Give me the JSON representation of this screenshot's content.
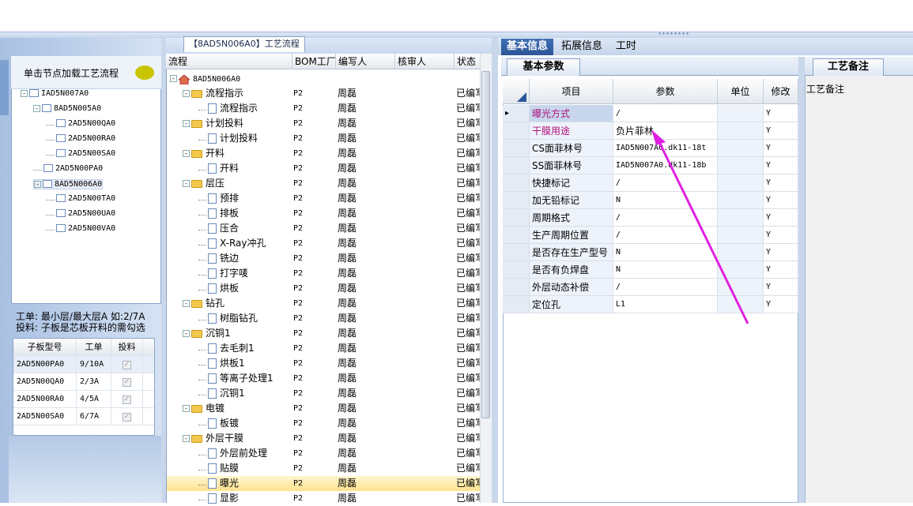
{
  "left": {
    "load_title": "单击节点加载工艺流程",
    "tree": [
      {
        "label": "IAD5N007A0",
        "level": 0,
        "pm": "-"
      },
      {
        "label": "8AD5N005A0",
        "level": 1,
        "pm": "-"
      },
      {
        "label": "2AD5N00QA0",
        "level": 2,
        "pm": ""
      },
      {
        "label": "2AD5N00RA0",
        "level": 2,
        "pm": ""
      },
      {
        "label": "2AD5N00SA0",
        "level": 2,
        "pm": ""
      },
      {
        "label": "2AD5N00PA0",
        "level": 1,
        "pm": ""
      },
      {
        "label": "8AD5N006A0",
        "level": 1,
        "pm": "-",
        "selected": true
      },
      {
        "label": "2AD5N00TA0",
        "level": 2,
        "pm": ""
      },
      {
        "label": "2AD5N00UA0",
        "level": 2,
        "pm": ""
      },
      {
        "label": "2AD5N00VA0",
        "level": 2,
        "pm": ""
      }
    ],
    "info_line1": "工单: 最小层/最大层A 如:2/7A",
    "info_line2": "投料: 子板是芯板开料的需勾选",
    "subgrid": {
      "headers": [
        "子板型号",
        "工单",
        "投料"
      ],
      "rows": [
        {
          "model": "2AD5N00PA0",
          "order": "9/10A",
          "check": "✓"
        },
        {
          "model": "2AD5N00QA0",
          "order": "2/3A",
          "check": "✓"
        },
        {
          "model": "2AD5N00RA0",
          "order": "4/5A",
          "check": "✓"
        },
        {
          "model": "2AD5N00SA0",
          "order": "6/7A",
          "check": "✓"
        }
      ]
    }
  },
  "middle": {
    "title": "【8AD5N006A0】工艺流程",
    "headers": [
      "流程",
      "BOM工厂",
      "编写人",
      "核审人",
      "状态"
    ],
    "root": "8AD5N006A0",
    "rows": [
      {
        "name": "流程指示",
        "type": "folder",
        "factory": "P2",
        "writer": "周磊",
        "status": "已编写"
      },
      {
        "name": "流程指示",
        "type": "doc",
        "factory": "P2",
        "writer": "周磊",
        "status": "已编写"
      },
      {
        "name": "计划投料",
        "type": "folder",
        "factory": "P2",
        "writer": "周磊",
        "status": "已编写"
      },
      {
        "name": "计划投料",
        "type": "doc",
        "factory": "P2",
        "writer": "周磊",
        "status": "已编写"
      },
      {
        "name": "开料",
        "type": "folder",
        "factory": "P2",
        "writer": "周磊",
        "status": "已编写"
      },
      {
        "name": "开料",
        "type": "doc",
        "factory": "P2",
        "writer": "周磊",
        "status": "已编写"
      },
      {
        "name": "层压",
        "type": "folder",
        "factory": "P2",
        "writer": "周磊",
        "status": "已编写"
      },
      {
        "name": "预排",
        "type": "doc",
        "factory": "P2",
        "writer": "周磊",
        "status": "已编写"
      },
      {
        "name": "排板",
        "type": "doc",
        "factory": "P2",
        "writer": "周磊",
        "status": "已编写"
      },
      {
        "name": "压合",
        "type": "doc",
        "factory": "P2",
        "writer": "周磊",
        "status": "已编写"
      },
      {
        "name": "X-Ray冲孔",
        "type": "doc",
        "factory": "P2",
        "writer": "周磊",
        "status": "已编写"
      },
      {
        "name": "铣边",
        "type": "doc",
        "factory": "P2",
        "writer": "周磊",
        "status": "已编写"
      },
      {
        "name": "打字唛",
        "type": "doc",
        "factory": "P2",
        "writer": "周磊",
        "status": "已编写"
      },
      {
        "name": "烘板",
        "type": "doc",
        "factory": "P2",
        "writer": "周磊",
        "status": "已编写"
      },
      {
        "name": "钻孔",
        "type": "folder",
        "factory": "P2",
        "writer": "周磊",
        "status": "已编写"
      },
      {
        "name": "树脂钻孔",
        "type": "doc",
        "factory": "P2",
        "writer": "周磊",
        "status": "已编写"
      },
      {
        "name": "沉铜1",
        "type": "folder",
        "factory": "P2",
        "writer": "周磊",
        "status": "已编写"
      },
      {
        "name": "去毛刺1",
        "type": "doc",
        "factory": "P2",
        "writer": "周磊",
        "status": "已编写"
      },
      {
        "name": "烘板1",
        "type": "doc",
        "factory": "P2",
        "writer": "周磊",
        "status": "已编写"
      },
      {
        "name": "等离子处理1",
        "type": "doc",
        "factory": "P2",
        "writer": "周磊",
        "status": "已编写"
      },
      {
        "name": "沉铜1",
        "type": "doc",
        "factory": "P2",
        "writer": "周磊",
        "status": "已编写"
      },
      {
        "name": "电镀",
        "type": "folder",
        "factory": "P2",
        "writer": "周磊",
        "status": "已编写"
      },
      {
        "name": "板镀",
        "type": "doc",
        "factory": "P2",
        "writer": "周磊",
        "status": "已编写"
      },
      {
        "name": "外层干膜",
        "type": "folder",
        "factory": "P2",
        "writer": "周磊",
        "status": "已编写"
      },
      {
        "name": "外层前处理",
        "type": "doc",
        "factory": "P2",
        "writer": "周磊",
        "status": "已编写"
      },
      {
        "name": "贴膜",
        "type": "doc",
        "factory": "P2",
        "writer": "周磊",
        "status": "已编写"
      },
      {
        "name": "曝光",
        "type": "doc",
        "factory": "P2",
        "writer": "周磊",
        "status": "已编写",
        "selected": true
      },
      {
        "name": "显影",
        "type": "doc",
        "factory": "P2",
        "writer": "周磊",
        "status": "已编写"
      }
    ]
  },
  "right": {
    "tabs": [
      "基本信息",
      "拓展信息",
      "工时"
    ],
    "subtab": "基本参数",
    "headers": [
      "项目",
      "参数",
      "单位",
      "修改"
    ],
    "rows": [
      {
        "item": "曝光方式",
        "param": "/",
        "unit": "",
        "mod": "Y",
        "highlight": true,
        "current": true
      },
      {
        "item": "干膜用途",
        "param": "负片菲林",
        "unit": "",
        "mod": "Y",
        "highlight": true
      },
      {
        "item": "CS面菲林号",
        "param": "IAD5N007A0.dk11-18t",
        "unit": "",
        "mod": "Y"
      },
      {
        "item": "SS面菲林号",
        "param": "IAD5N007A0.dk11-18b",
        "unit": "",
        "mod": "Y"
      },
      {
        "item": "快捷标记",
        "param": "/",
        "unit": "",
        "mod": "Y"
      },
      {
        "item": "加无铅标记",
        "param": "N",
        "unit": "",
        "mod": "Y"
      },
      {
        "item": "周期格式",
        "param": "/",
        "unit": "",
        "mod": "Y"
      },
      {
        "item": "生产周期位置",
        "param": "/",
        "unit": "",
        "mod": "Y"
      },
      {
        "item": "是否存在生产型号",
        "param": "N",
        "unit": "",
        "mod": "Y"
      },
      {
        "item": "是否有负焊盘",
        "param": "N",
        "unit": "",
        "mod": "Y"
      },
      {
        "item": "外层动态补偿",
        "param": "/",
        "unit": "",
        "mod": "Y"
      },
      {
        "item": "定位孔",
        "param": "L1",
        "unit": "",
        "mod": "Y"
      }
    ],
    "note_tab": "工艺备注",
    "note_label": "工艺备注"
  },
  "colors": {
    "highlight": "#b0107a",
    "arrow": "#e020e0",
    "accent": "#2c5597"
  }
}
